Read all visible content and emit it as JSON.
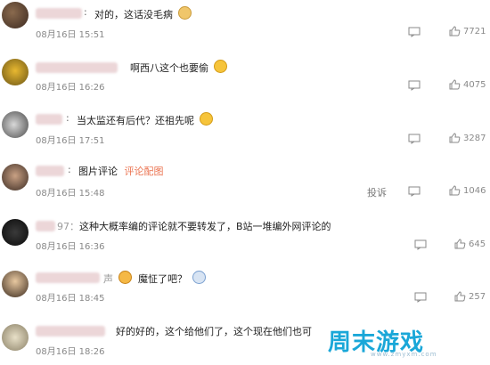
{
  "comments": [
    {
      "body": "对的，这话没毛病",
      "time": "08月16日 15:51",
      "likes": "7721",
      "emoji": "dog-emoji"
    },
    {
      "body": "啊西八这个也要偷",
      "time": "08月16日 16:26",
      "likes": "4075",
      "emoji": "laughing-emoji"
    },
    {
      "body": "当太监还有后代？还祖先呢",
      "time": "08月16日 17:51",
      "likes": "3287",
      "emoji": "laughing-emoji"
    },
    {
      "body": "图片评论",
      "link": "评论配图",
      "time": "08月16日 15:48",
      "likes": "1046",
      "report": "投诉"
    },
    {
      "prefix": "97：",
      "body": "这种大概率编的评论就不要转发了，B站一堆编外网评论的",
      "time": "08月16日 16:36",
      "likes": "645"
    },
    {
      "prefix": "声",
      "body": "魔怔了吧？",
      "time": "08月16日 18:45",
      "likes": "257",
      "emoji": "angry-emoji"
    },
    {
      "body": "好的好的，这个给他们了，这个现在他们也可",
      "time": "08月16日 18:26"
    }
  ],
  "watermark": {
    "text": "周末游戏",
    "sub": "www.zmyxm.com"
  },
  "colors": {
    "link": "#eb7350",
    "watermark": "#1aa7d8"
  }
}
